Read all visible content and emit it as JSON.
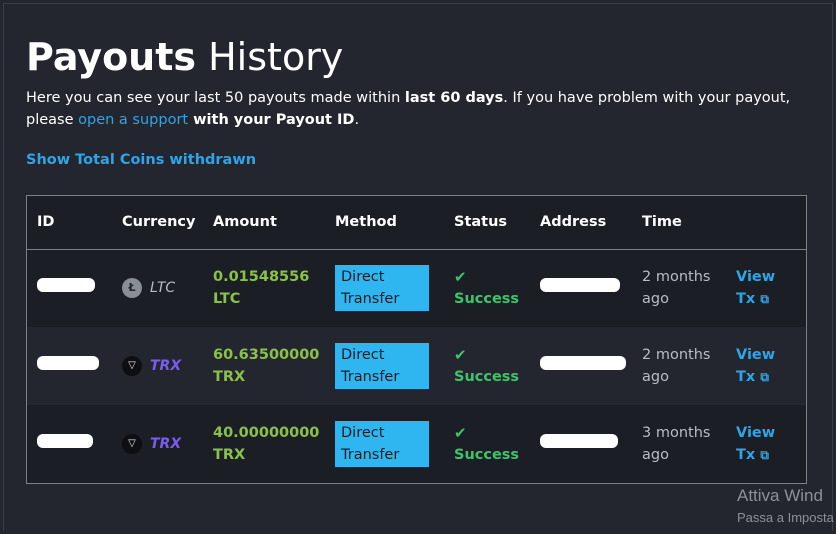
{
  "page": {
    "title_bold": "Payouts",
    "title_rest": " History",
    "intro": {
      "part1": "Here you can see your last 50 payouts made within ",
      "bold1": "last 60 days",
      "part2": ". If you have problem with your payout, please ",
      "link": "open a support",
      "bold2": " with your Payout ID",
      "part3": "."
    },
    "show_total_label": "Show Total Coins withdrawn"
  },
  "table": {
    "headers": [
      "ID",
      "Currency",
      "Amount",
      "Method",
      "Status",
      "Address",
      "Time",
      ""
    ],
    "rows": [
      {
        "currency": "LTC",
        "currency_icon": "litecoin-icon",
        "amount_line1": "0.01548556",
        "amount_line2": "LTC",
        "method_line1": "Direct",
        "method_line2": "Transfer",
        "status": "Success",
        "time_line1": "2 months",
        "time_line2": "ago",
        "view_line1": "View",
        "view_line2": "Tx"
      },
      {
        "currency": "TRX",
        "currency_icon": "tron-icon",
        "amount_line1": "60.63500000",
        "amount_line2": "TRX",
        "method_line1": "Direct",
        "method_line2": "Transfer",
        "status": "Success",
        "time_line1": "2 months",
        "time_line2": "ago",
        "view_line1": "View",
        "view_line2": "Tx"
      },
      {
        "currency": "TRX",
        "currency_icon": "tron-icon",
        "amount_line1": "40.00000000",
        "amount_line2": "TRX",
        "method_line1": "Direct",
        "method_line2": "Transfer",
        "status": "Success",
        "time_line1": "3 months",
        "time_line2": "ago",
        "view_line1": "View",
        "view_line2": "Tx"
      }
    ]
  },
  "watermark": {
    "line1": "Attiva Wind",
    "line2": "Passa a Imposta"
  },
  "colors": {
    "background": "#23262f",
    "link": "#2fa4e7",
    "amount": "#8ac249",
    "success": "#3fc36a",
    "method_badge": "#2fb6f0",
    "trx_text": "#7b5cf0"
  }
}
